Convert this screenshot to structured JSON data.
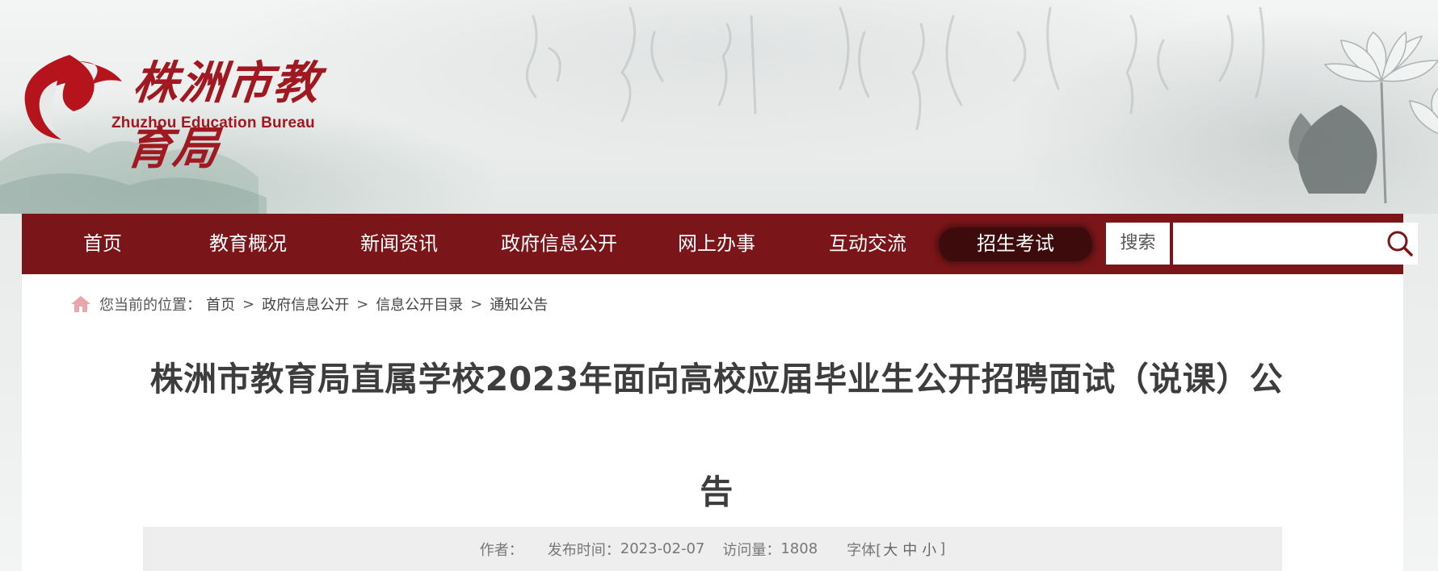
{
  "header": {
    "logo_cn": "株洲市教育局",
    "logo_en": "Zhuzhou Education Bureau",
    "logo_icon": "flame-logo-icon"
  },
  "nav": {
    "items": [
      {
        "label": "首页"
      },
      {
        "label": "教育概况"
      },
      {
        "label": "新闻资讯"
      },
      {
        "label": "政府信息公开"
      },
      {
        "label": "网上办事"
      },
      {
        "label": "互动交流"
      },
      {
        "label": "招生考试",
        "active": true
      }
    ],
    "search_label": "搜索",
    "search_value": "",
    "search_placeholder": "",
    "search_icon": "search-icon"
  },
  "breadcrumb": {
    "prefix": "您当前的位置：",
    "items": [
      "首页",
      "政府信息公开",
      "信息公开目录",
      "通知公告"
    ],
    "separator": ">"
  },
  "article": {
    "title": "株洲市教育局直属学校2023年面向高校应届毕业生公开招聘面试（说课）公告",
    "meta": {
      "author_label": "作者：",
      "author": "",
      "date_label": "发布时间：",
      "date": "2023-02-07",
      "views_label": "访问量：",
      "views": "1808",
      "font_label": "字体[",
      "font_large": "大",
      "font_medium": "中",
      "font_small": "小",
      "font_close": "]"
    }
  },
  "colors": {
    "nav_bg": "#7a1619",
    "nav_active_bg": "#3e0b0d",
    "brand_red": "#a01820",
    "meta_bg": "#eeeeee"
  }
}
